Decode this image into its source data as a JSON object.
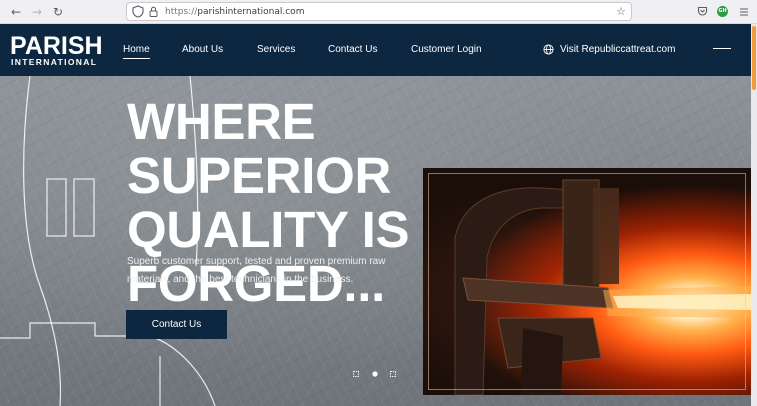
{
  "browser": {
    "url_scheme": "https://",
    "url_host": "parishinternational.com",
    "ext_badge": "GH",
    "icons": [
      "back-arrow-icon",
      "forward-arrow-icon",
      "reload-icon",
      "shield-icon",
      "lock-icon",
      "star-icon",
      "pocket-icon",
      "extension-icon",
      "menu-icon"
    ]
  },
  "header": {
    "logo_top": "PARISH",
    "logo_bottom": "INTERNATIONAL",
    "nav": [
      {
        "label": "Home",
        "active": true
      },
      {
        "label": "About Us"
      },
      {
        "label": "Services"
      },
      {
        "label": "Contact Us"
      },
      {
        "label": "Customer Login"
      }
    ],
    "visit_label": "Visit Republiccattreat.com"
  },
  "hero": {
    "headline_line1": "WHERE SUPERIOR",
    "headline_line2": "QUALITY IS",
    "headline_line3": "FORGED...",
    "subtext": "Superb customer support, tested and proven premium raw materials, and the best technicians in the business.",
    "cta_label": "Contact Us",
    "slides_count": 3,
    "active_slide": 2
  },
  "colors": {
    "navy": "#0d2740",
    "scroll_thumb": "#f29b3a",
    "white": "#ffffff"
  }
}
